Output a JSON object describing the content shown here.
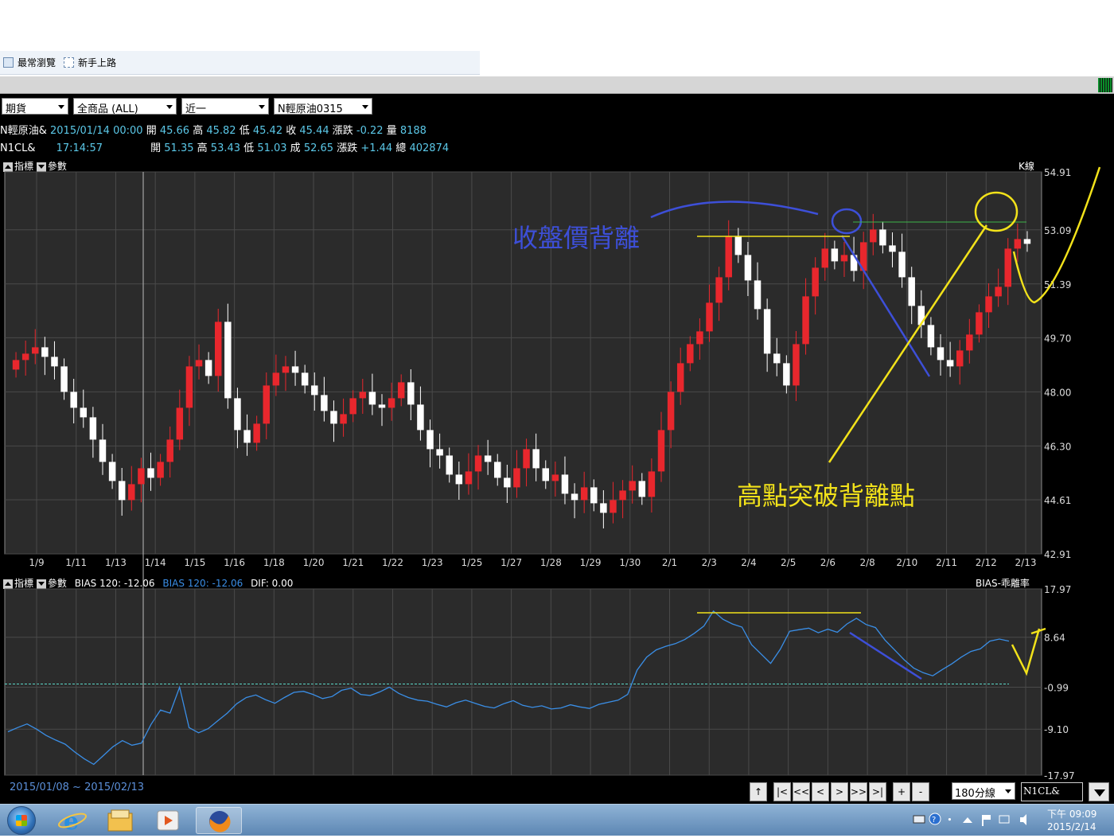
{
  "browser": {
    "bookmarks": [
      {
        "label": "最常瀏覽"
      },
      {
        "label": "新手上路"
      }
    ]
  },
  "toolbar": {
    "market": "期貨",
    "product": "全商品   (ALL)",
    "month": "近一",
    "symbol": "N輕原油0315"
  },
  "quote1": {
    "name": "N輕原油&",
    "datetime": "2015/01/14 00:00",
    "open_label": "開",
    "open": "45.66",
    "high_label": "高",
    "high": "45.82",
    "low_label": "低",
    "low": "45.42",
    "close_label": "收",
    "close": "45.44",
    "change_label": "漲跌",
    "change": "-0.22",
    "vol_label": "量",
    "vol": "8188"
  },
  "quote2": {
    "name": "N1CL&",
    "time": "17:14:57",
    "open_label": "開",
    "open": "51.35",
    "high_label": "高",
    "high": "53.43",
    "low_label": "低",
    "low": "51.03",
    "close_label": "成",
    "close": "52.65",
    "change_label": "漲跌",
    "change": "+1.44",
    "total_label": "總",
    "total": "402874"
  },
  "main_panel": {
    "indicator_label": "指標",
    "param_label": "參數",
    "title": "K線"
  },
  "sub_panel": {
    "indicator_label": "指標",
    "param_label": "參數",
    "bias1": "BIAS 120:  -12.06",
    "bias2": "BIAS 120:  -12.06",
    "dif": "DIF:    0.00",
    "title": "BIAS-乖離率"
  },
  "annotations": {
    "close_divergence": "收盤價背離",
    "high_breakout": "高點突破背離點"
  },
  "footer": {
    "date_range": "2015/01/08   ~   2015/02/13",
    "nav_buttons": [
      "↑",
      "|<",
      "<<",
      "<",
      ">",
      ">>",
      ">|",
      "+",
      "-"
    ],
    "period": "180分線",
    "symbol_box": "N1CL&"
  },
  "taskbar": {
    "clock_time": "下午 09:09",
    "clock_date": "2015/2/14",
    "apps": [
      "internet-explorer",
      "file-explorer",
      "media-player",
      "firefox"
    ]
  },
  "colors": {
    "up": "#e8272d",
    "down": "#ffffff",
    "bias_line": "#3a8ee6",
    "grid": "#4a4a4a",
    "panel_bg": "#2b2b2b",
    "ann_blue": "#3d4fd8",
    "ann_yellow": "#f2e21a"
  },
  "chart_data": [
    {
      "type": "candlestick",
      "title": "K線",
      "yticks": [
        54.91,
        53.09,
        51.39,
        49.7,
        48.0,
        46.3,
        44.61,
        42.91
      ],
      "ylim": [
        42.91,
        54.91
      ],
      "xticks": [
        "1/9",
        "1/11",
        "1/13",
        "1/14",
        "1/15",
        "1/16",
        "1/18",
        "1/20",
        "1/21",
        "1/22",
        "1/23",
        "1/25",
        "1/27",
        "1/28",
        "1/29",
        "1/30",
        "2/1",
        "2/3",
        "2/4",
        "2/5",
        "2/6",
        "2/8",
        "2/10",
        "2/11",
        "2/12",
        "2/13"
      ],
      "closes": [
        49.0,
        49.2,
        49.4,
        49.1,
        48.8,
        48.0,
        47.5,
        47.2,
        46.5,
        45.8,
        45.2,
        44.6,
        45.1,
        45.6,
        45.3,
        45.8,
        46.5,
        47.5,
        48.8,
        49.0,
        48.5,
        50.2,
        47.8,
        46.8,
        46.4,
        47.0,
        48.2,
        48.6,
        48.8,
        48.6,
        48.2,
        47.9,
        47.4,
        47.0,
        47.3,
        47.8,
        48.0,
        47.6,
        47.5,
        47.8,
        48.3,
        47.6,
        46.8,
        46.2,
        46.0,
        45.4,
        45.1,
        45.5,
        46.0,
        45.8,
        45.3,
        45.0,
        45.6,
        46.2,
        45.6,
        45.2,
        45.4,
        44.8,
        44.6,
        45.0,
        44.5,
        44.2,
        44.6,
        44.9,
        45.2,
        44.7,
        45.5,
        46.8,
        48.0,
        48.9,
        49.5,
        49.9,
        50.8,
        51.6,
        52.9,
        52.3,
        51.5,
        50.6,
        49.2,
        48.9,
        48.2,
        49.5,
        51.0,
        51.9,
        52.5,
        52.1,
        52.3,
        51.8,
        52.7,
        53.1,
        52.6,
        52.4,
        51.6,
        50.7,
        50.1,
        49.4,
        49.0,
        48.8,
        49.3,
        49.8,
        50.5,
        51.0,
        51.3,
        52.5,
        52.8,
        52.65
      ],
      "highs_lows_note": "wicks approximated"
    },
    {
      "type": "line",
      "title": "BIAS-乖離率",
      "series": [
        {
          "name": "BIAS 120",
          "color": "#3a8ee6"
        }
      ],
      "yticks": [
        17.97,
        8.64,
        -0.99,
        -9.1,
        -17.97
      ],
      "ylim": [
        -17.97,
        17.97
      ],
      "values": [
        -9.6,
        -8.8,
        -8.1,
        -9.1,
        -10.3,
        -11.2,
        -12.0,
        -13.5,
        -14.8,
        -15.9,
        -14.2,
        -12.5,
        -11.3,
        -12.2,
        -11.8,
        -8.2,
        -5.4,
        -6.0,
        -1.0,
        -8.8,
        -9.8,
        -9.0,
        -7.5,
        -6.0,
        -4.2,
        -3.0,
        -2.5,
        -3.4,
        -4.1,
        -3.0,
        -2.0,
        -1.8,
        -2.4,
        -3.2,
        -2.8,
        -1.6,
        -1.2,
        -2.4,
        -2.6,
        -1.9,
        -1.0,
        -2.2,
        -3.0,
        -3.5,
        -3.7,
        -4.3,
        -4.8,
        -4.0,
        -3.5,
        -4.1,
        -4.7,
        -5.0,
        -4.2,
        -3.6,
        -4.5,
        -4.9,
        -4.6,
        -5.2,
        -5.0,
        -4.4,
        -4.8,
        -5.1,
        -4.3,
        -3.9,
        -3.5,
        -2.4,
        2.3,
        4.8,
        6.2,
        6.9,
        7.4,
        8.2,
        9.4,
        10.8,
        13.7,
        12.1,
        11.2,
        10.6,
        7.2,
        5.4,
        3.6,
        6.3,
        9.8,
        10.1,
        10.4,
        9.5,
        10.2,
        9.6,
        11.2,
        12.3,
        11.1,
        10.5,
        8.1,
        6.2,
        4.3,
        2.7,
        1.8,
        1.2,
        2.4,
        3.5,
        4.8,
        5.9,
        6.4,
        7.9,
        8.3,
        7.9
      ]
    }
  ]
}
